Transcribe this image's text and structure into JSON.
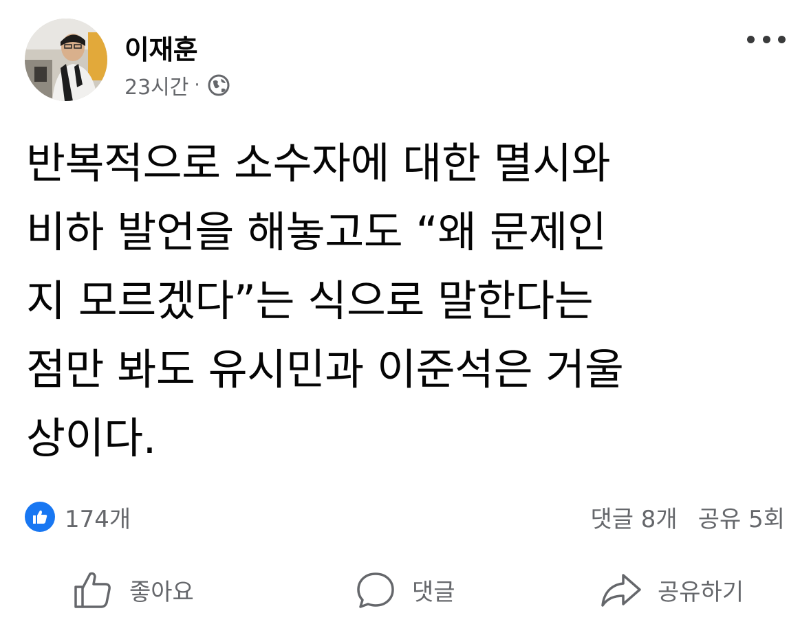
{
  "header": {
    "author_name": "이재훈",
    "time": "23시간",
    "separator": "·",
    "audience_icon": "globe-icon",
    "more_icon": "more-options-icon"
  },
  "post": {
    "text": "반복적으로 소수자에 대한 멸시와\n비하 발언을 해놓고도 “왜 문제인\n지 모르겠다”는 식으로 말한다는\n점만 봐도 유시민과 이준석은 거울\n상이다."
  },
  "stats": {
    "reaction_icon": "like-badge-icon",
    "reaction_count": "174개",
    "comments": "댓글 8개",
    "shares": "공유 5회"
  },
  "actions": {
    "like": {
      "label": "좋아요",
      "icon": "thumbs-up-icon"
    },
    "comment": {
      "label": "댓글",
      "icon": "comment-bubble-icon"
    },
    "share": {
      "label": "공유하기",
      "icon": "share-arrow-icon"
    }
  },
  "colors": {
    "accent": "#1877f2",
    "secondary_text": "#65676b",
    "primary_text": "#050505"
  }
}
